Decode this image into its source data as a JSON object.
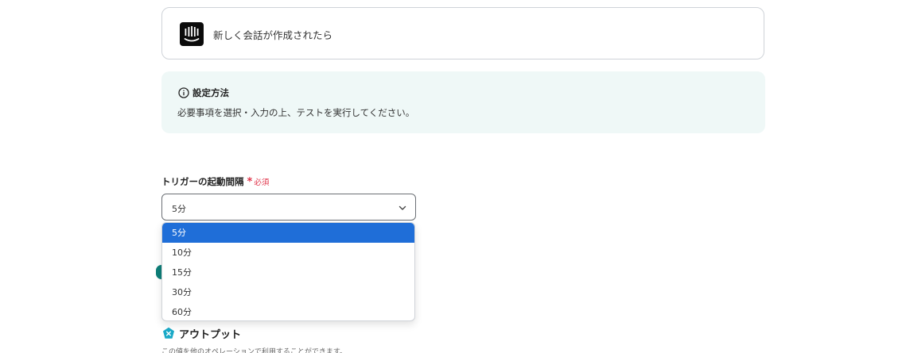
{
  "trigger": {
    "app_icon": "intercom-icon",
    "title": "新しく会話が作成されたら"
  },
  "info": {
    "icon": "info-circle-icon",
    "title": "設定方法",
    "text": "必要事項を選択・入力の上、テストを実行してください。"
  },
  "field": {
    "label": "トリガーの起動間隔",
    "required_mark": "*",
    "required_text": "必須",
    "selected_value": "5分",
    "options": [
      "5分",
      "10分",
      "15分",
      "30分",
      "60分"
    ],
    "highlighted_option": "5分"
  },
  "output": {
    "icon": "output-badge-icon",
    "title": "アウトプット",
    "description": "この値を他のオペレーションで利用することができます。"
  },
  "colors": {
    "accent": "#1f6ed8",
    "required": "#e0344a",
    "info_bg": "#eff8f7",
    "output_icon": "#1aa9c7"
  }
}
